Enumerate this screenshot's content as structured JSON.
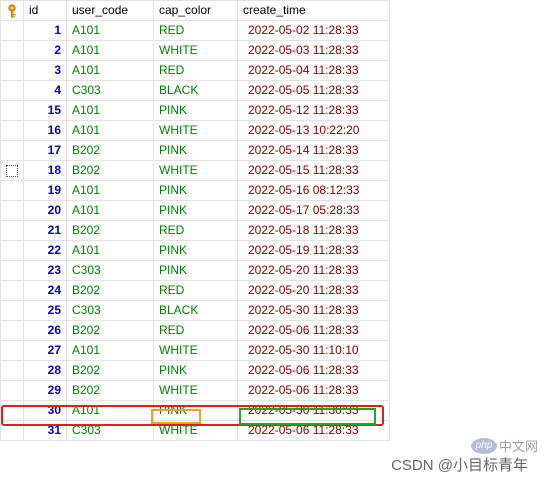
{
  "columns": [
    "id",
    "user_code",
    "cap_color",
    "create_time"
  ],
  "rows": [
    {
      "id": "1",
      "user_code": "A101",
      "cap_color": "RED",
      "create_time": "2022-05-02 11:28:33"
    },
    {
      "id": "2",
      "user_code": "A101",
      "cap_color": "WHITE",
      "create_time": "2022-05-03 11:28:33"
    },
    {
      "id": "3",
      "user_code": "A101",
      "cap_color": "RED",
      "create_time": "2022-05-04 11:28:33"
    },
    {
      "id": "4",
      "user_code": "C303",
      "cap_color": "BLACK",
      "create_time": "2022-05-05 11:28:33"
    },
    {
      "id": "15",
      "user_code": "A101",
      "cap_color": "PINK",
      "create_time": "2022-05-12 11:28:33"
    },
    {
      "id": "16",
      "user_code": "A101",
      "cap_color": "WHITE",
      "create_time": "2022-05-13 10:22:20"
    },
    {
      "id": "17",
      "user_code": "B202",
      "cap_color": "PINK",
      "create_time": "2022-05-14 11:28:33"
    },
    {
      "id": "18",
      "user_code": "B202",
      "cap_color": "WHITE",
      "create_time": "2022-05-15 11:28:33",
      "current": true
    },
    {
      "id": "19",
      "user_code": "A101",
      "cap_color": "PINK",
      "create_time": "2022-05-16 08:12:33"
    },
    {
      "id": "20",
      "user_code": "A101",
      "cap_color": "PINK",
      "create_time": "2022-05-17 05:28:33"
    },
    {
      "id": "21",
      "user_code": "B202",
      "cap_color": "RED",
      "create_time": "2022-05-18 11:28:33"
    },
    {
      "id": "22",
      "user_code": "A101",
      "cap_color": "PINK",
      "create_time": "2022-05-19 11:28:33"
    },
    {
      "id": "23",
      "user_code": "C303",
      "cap_color": "PINK",
      "create_time": "2022-05-20 11:28:33"
    },
    {
      "id": "24",
      "user_code": "B202",
      "cap_color": "RED",
      "create_time": "2022-05-20 11:28:33"
    },
    {
      "id": "25",
      "user_code": "C303",
      "cap_color": "BLACK",
      "create_time": "2022-05-30 11:28:33"
    },
    {
      "id": "26",
      "user_code": "B202",
      "cap_color": "RED",
      "create_time": "2022-05-06 11:28:33"
    },
    {
      "id": "27",
      "user_code": "A101",
      "cap_color": "WHITE",
      "create_time": "2022-05-30 11:10:10"
    },
    {
      "id": "28",
      "user_code": "B202",
      "cap_color": "PINK",
      "create_time": "2022-05-06 11:28:33"
    },
    {
      "id": "29",
      "user_code": "B202",
      "cap_color": "WHITE",
      "create_time": "2022-05-06 11:28:33"
    },
    {
      "id": "30",
      "user_code": "A101",
      "cap_color": "PINK",
      "create_time": "2022-05-30 11:30:33",
      "highlighted": true
    },
    {
      "id": "31",
      "user_code": "C303",
      "cap_color": "WHITE",
      "create_time": "2022-05-06 11:28:33"
    }
  ],
  "icons": {
    "primary_key": "key-icon",
    "current_row": "row-marker-icon"
  },
  "highlight_colors": {
    "row": "#e02020",
    "cap_color": "#f0a020",
    "create_time": "2022-05-30 11:30:33 box #2aa02a"
  },
  "watermark": {
    "text": "CSDN @小目标青年",
    "logo_text": "php",
    "logo_caption": "中文网"
  }
}
